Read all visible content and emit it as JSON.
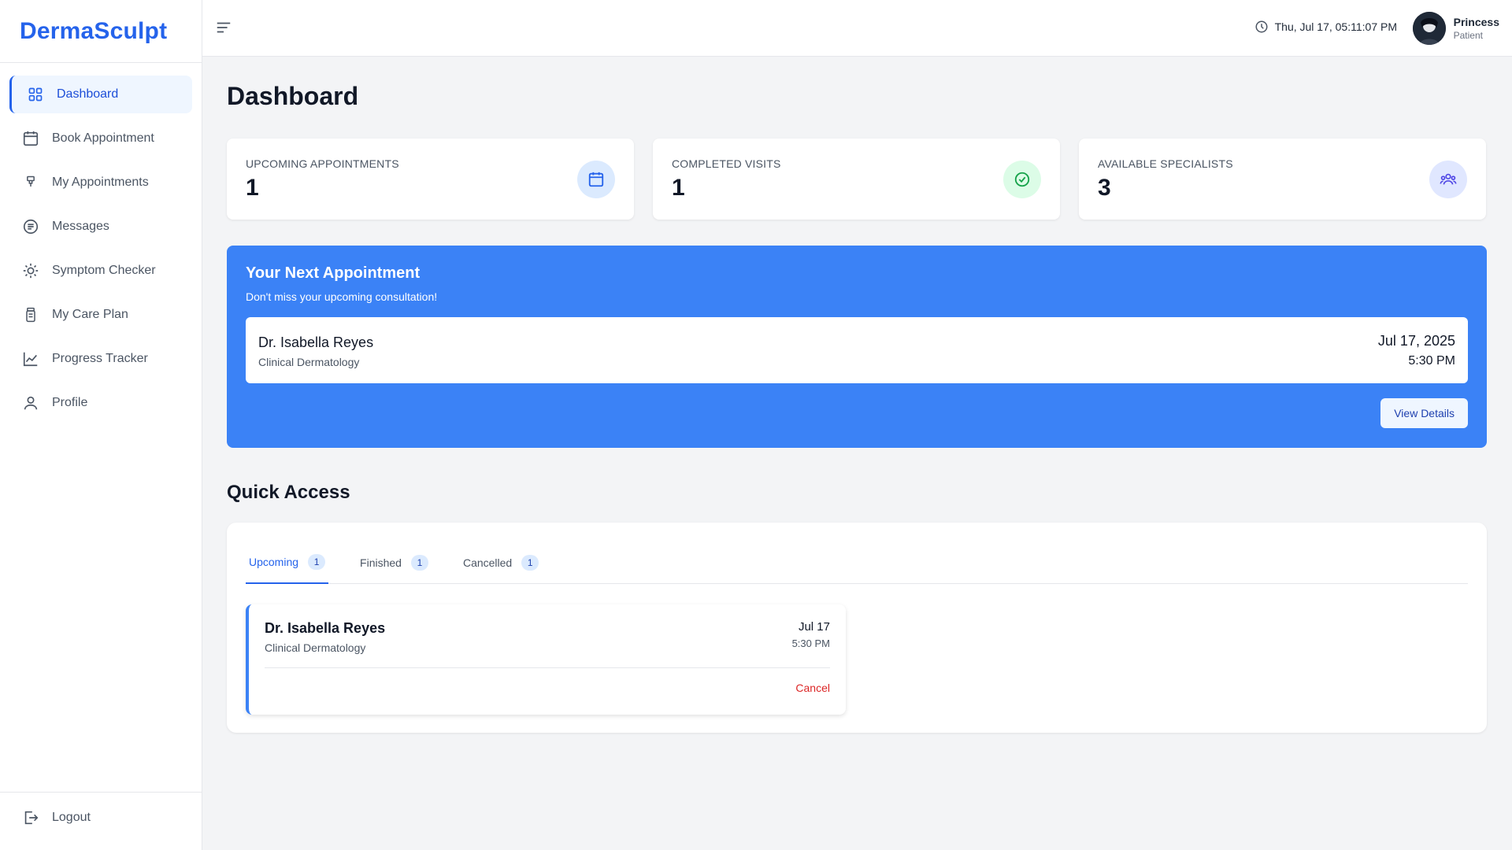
{
  "brand": "DermaSculpt",
  "sidebar": {
    "items": [
      {
        "label": "Dashboard",
        "icon": "grid-icon",
        "active": true
      },
      {
        "label": "Book Appointment",
        "icon": "calendar-icon"
      },
      {
        "label": "My Appointments",
        "icon": "clipboard-icon"
      },
      {
        "label": "Messages",
        "icon": "message-icon"
      },
      {
        "label": "Symptom Checker",
        "icon": "sun-icon"
      },
      {
        "label": "My Care Plan",
        "icon": "bottle-icon"
      },
      {
        "label": "Progress Tracker",
        "icon": "chart-line-icon"
      },
      {
        "label": "Profile",
        "icon": "user-icon"
      }
    ],
    "logout": "Logout"
  },
  "header": {
    "datetime": "Thu, Jul 17, 05:11:07 PM",
    "user_name": "Princess",
    "user_role": "Patient"
  },
  "page_title": "Dashboard",
  "stats": [
    {
      "label": "UPCOMING APPOINTMENTS",
      "value": "1",
      "icon": "calendar-icon",
      "color": "#2563eb",
      "bg": "#dbeafe"
    },
    {
      "label": "COMPLETED VISITS",
      "value": "1",
      "icon": "check-circle-icon",
      "color": "#16a34a",
      "bg": "#dcfce7"
    },
    {
      "label": "AVAILABLE SPECIALISTS",
      "value": "3",
      "icon": "users-icon",
      "color": "#4f46e5",
      "bg": "#e0e7ff"
    }
  ],
  "next_appointment": {
    "title": "Your Next Appointment",
    "subtitle": "Don't miss your upcoming consultation!",
    "doctor": "Dr. Isabella Reyes",
    "specialty": "Clinical Dermatology",
    "date": "Jul 17, 2025",
    "time": "5:30 PM",
    "button": "View Details"
  },
  "quick_access": {
    "title": "Quick Access",
    "tabs": [
      {
        "label": "Upcoming",
        "count": "1",
        "active": true
      },
      {
        "label": "Finished",
        "count": "1"
      },
      {
        "label": "Cancelled",
        "count": "1"
      }
    ],
    "item": {
      "doctor": "Dr. Isabella Reyes",
      "specialty": "Clinical Dermatology",
      "date": "Jul 17",
      "time": "5:30 PM",
      "cancel": "Cancel"
    }
  },
  "colors": {
    "brand": "#2563eb",
    "banner": "#3b82f6",
    "danger": "#dc2626"
  }
}
